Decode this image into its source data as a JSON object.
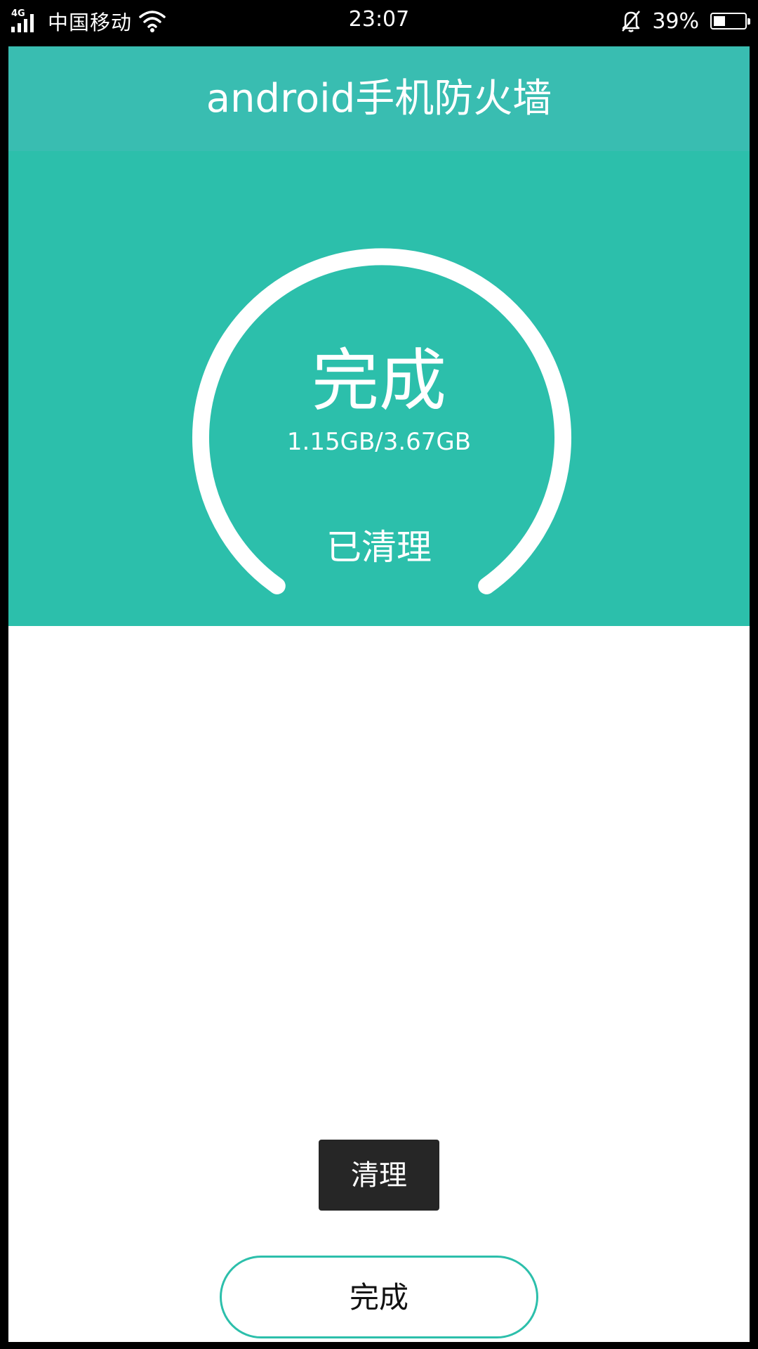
{
  "status_bar": {
    "network": "4G",
    "carrier": "中国移动",
    "time": "23:07",
    "battery_percent": "39%",
    "battery_level": 0.39,
    "icons": [
      "signal-icon",
      "wifi-icon",
      "bell-muted-icon",
      "battery-icon"
    ]
  },
  "header": {
    "title": "android手机防火墙"
  },
  "gauge": {
    "status": "完成",
    "size": "1.15GB/3.67GB",
    "label": "已清理"
  },
  "actions": {
    "clean_label": "清理",
    "done_label": "完成"
  },
  "colors": {
    "title_bar": "#39bdb1",
    "hero": "#2cbfab",
    "accent": "#2cbfab",
    "clean_button": "#262626"
  }
}
